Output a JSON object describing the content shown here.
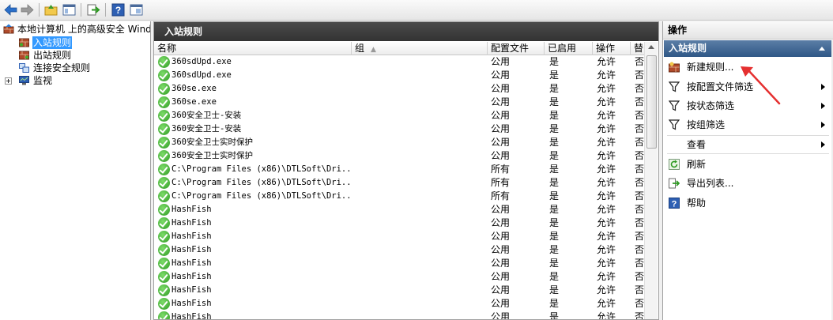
{
  "left_tree": {
    "root_label": "本地计算机 上的高级安全 Windows",
    "items": [
      {
        "label": "入站规则",
        "selected": true
      },
      {
        "label": "出站规则",
        "selected": false
      },
      {
        "label": "连接安全规则",
        "selected": false
      },
      {
        "label": "监视",
        "selected": false
      }
    ]
  },
  "center": {
    "title": "入站规则",
    "columns": {
      "name": "名称",
      "group": "组",
      "profile": "配置文件",
      "enabled": "已启用",
      "action": "操作",
      "override": "替"
    },
    "rows": [
      {
        "name": "360sdUpd.exe",
        "profile": "公用",
        "enabled": "是",
        "action": "允许",
        "override": "否"
      },
      {
        "name": "360sdUpd.exe",
        "profile": "公用",
        "enabled": "是",
        "action": "允许",
        "override": "否"
      },
      {
        "name": "360se.exe",
        "profile": "公用",
        "enabled": "是",
        "action": "允许",
        "override": "否"
      },
      {
        "name": "360se.exe",
        "profile": "公用",
        "enabled": "是",
        "action": "允许",
        "override": "否"
      },
      {
        "name": "360安全卫士-安装",
        "profile": "公用",
        "enabled": "是",
        "action": "允许",
        "override": "否"
      },
      {
        "name": "360安全卫士-安装",
        "profile": "公用",
        "enabled": "是",
        "action": "允许",
        "override": "否"
      },
      {
        "name": "360安全卫士实时保护",
        "profile": "公用",
        "enabled": "是",
        "action": "允许",
        "override": "否"
      },
      {
        "name": "360安全卫士实时保护",
        "profile": "公用",
        "enabled": "是",
        "action": "允许",
        "override": "否"
      },
      {
        "name": "C:\\Program Files (x86)\\DTLSoft\\Dri...",
        "profile": "所有",
        "enabled": "是",
        "action": "允许",
        "override": "否"
      },
      {
        "name": "C:\\Program Files (x86)\\DTLSoft\\Dri...",
        "profile": "所有",
        "enabled": "是",
        "action": "允许",
        "override": "否"
      },
      {
        "name": "C:\\Program Files (x86)\\DTLSoft\\Dri...",
        "profile": "所有",
        "enabled": "是",
        "action": "允许",
        "override": "否"
      },
      {
        "name": "HashFish",
        "profile": "公用",
        "enabled": "是",
        "action": "允许",
        "override": "否"
      },
      {
        "name": "HashFish",
        "profile": "公用",
        "enabled": "是",
        "action": "允许",
        "override": "否"
      },
      {
        "name": "HashFish",
        "profile": "公用",
        "enabled": "是",
        "action": "允许",
        "override": "否"
      },
      {
        "name": "HashFish",
        "profile": "公用",
        "enabled": "是",
        "action": "允许",
        "override": "否"
      },
      {
        "name": "HashFish",
        "profile": "公用",
        "enabled": "是",
        "action": "允许",
        "override": "否"
      },
      {
        "name": "HashFish",
        "profile": "公用",
        "enabled": "是",
        "action": "允许",
        "override": "否"
      },
      {
        "name": "HashFish",
        "profile": "公用",
        "enabled": "是",
        "action": "允许",
        "override": "否"
      },
      {
        "name": "HashFish",
        "profile": "公用",
        "enabled": "是",
        "action": "允许",
        "override": "否"
      },
      {
        "name": "HashFish",
        "profile": "公用",
        "enabled": "是",
        "action": "允许",
        "override": "否"
      }
    ]
  },
  "actions_pane": {
    "title": "操作",
    "section": "入站规则",
    "items": [
      {
        "label": "新建规则...",
        "icon": "new-rule-icon",
        "submenu": false
      },
      {
        "label": "按配置文件筛选",
        "icon": "filter-icon",
        "submenu": true
      },
      {
        "label": "按状态筛选",
        "icon": "filter-icon",
        "submenu": true
      },
      {
        "label": "按组筛选",
        "icon": "filter-icon",
        "submenu": true
      },
      {
        "label": "查看",
        "icon": "",
        "submenu": true
      },
      {
        "label": "刷新",
        "icon": "refresh-icon",
        "submenu": false
      },
      {
        "label": "导出列表...",
        "icon": "export-icon",
        "submenu": false
      },
      {
        "label": "帮助",
        "icon": "help-icon",
        "submenu": false
      }
    ]
  },
  "colors": {
    "accent": "#3399ff",
    "title_bar": "#3c3c3c",
    "section_bar": "#2f5786",
    "arrow": "#e53030"
  }
}
